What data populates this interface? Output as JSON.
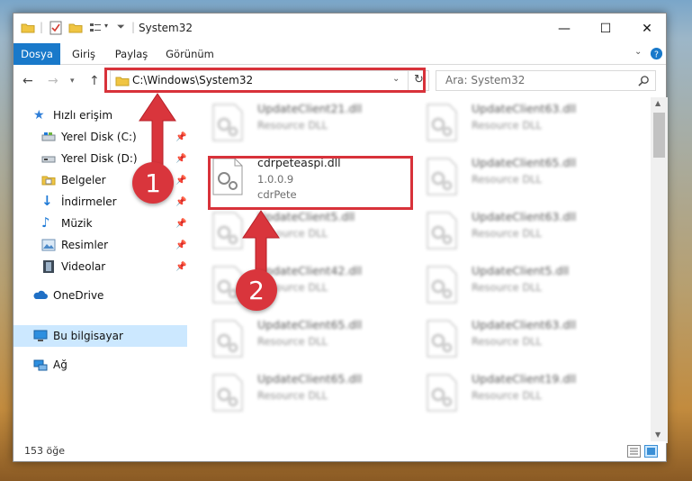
{
  "window": {
    "title": "System32"
  },
  "ribbon": {
    "tabs": [
      "Dosya",
      "Giriş",
      "Paylaş",
      "Görünüm"
    ]
  },
  "address": {
    "path": "C:\\Windows\\System32"
  },
  "search": {
    "placeholder": "Ara: System32"
  },
  "sidebar": {
    "quick_access": "Hızlı erişim",
    "items": [
      "Yerel Disk (C:)",
      "Yerel Disk (D:)",
      "Belgeler",
      "İndirmeler",
      "Müzik",
      "Resimler",
      "Videolar"
    ],
    "onedrive": "OneDrive",
    "this_pc": "Bu bilgisayar",
    "network": "Ağ"
  },
  "files_left": [
    {
      "name": "UpdateClient21.dll",
      "desc": "Resource DLL"
    },
    {
      "name": "cdrpeteaspi.dll",
      "version": "1.0.0.9",
      "company": "cdrPete"
    },
    {
      "name": "UpdateClient5.dll",
      "desc": "Resource DLL"
    },
    {
      "name": "UpdateClient42.dll",
      "desc": "Resource DLL"
    },
    {
      "name": "UpdateClient65.dll",
      "desc": "Resource DLL"
    },
    {
      "name": "UpdateClient65.dll",
      "desc": "Resource DLL"
    }
  ],
  "files_right": [
    {
      "name": "UpdateClient63.dll",
      "desc": "Resource DLL"
    },
    {
      "name": "UpdateClient65.dll",
      "desc": "Resource DLL"
    },
    {
      "name": "UpdateClient63.dll",
      "desc": "Resource DLL"
    },
    {
      "name": "UpdateClient5.dll",
      "desc": "Resource DLL"
    },
    {
      "name": "UpdateClient63.dll",
      "desc": "Resource DLL"
    },
    {
      "name": "UpdateClient19.dll",
      "desc": "Resource DLL"
    }
  ],
  "status": {
    "count": "153 öğe"
  },
  "annotations": {
    "step1": "1",
    "step2": "2"
  },
  "colors": {
    "accent": "#1979ca",
    "highlight": "#d8323a"
  }
}
